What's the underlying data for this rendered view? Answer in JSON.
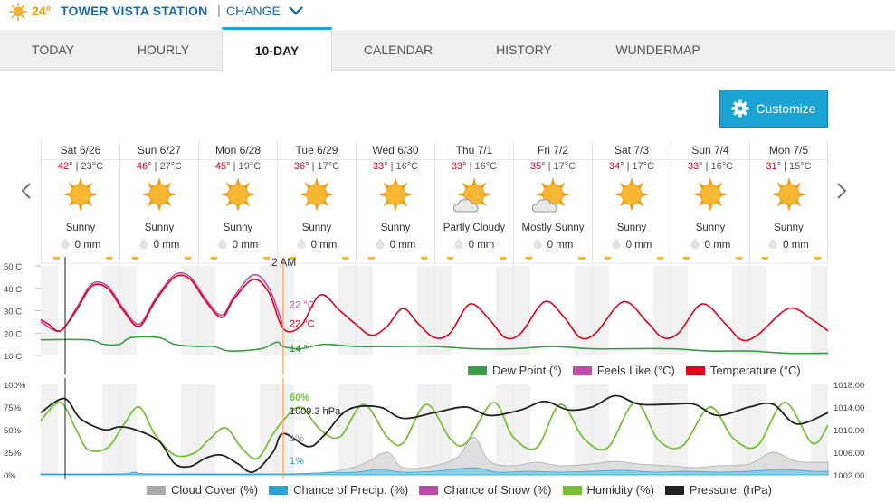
{
  "header": {
    "current_temp": "24°",
    "station_name": "TOWER VISTA STATION",
    "separator": "|",
    "change_label": "CHANGE"
  },
  "tabs": [
    {
      "label": "TODAY",
      "active": false
    },
    {
      "label": "HOURLY",
      "active": false
    },
    {
      "label": "10-DAY",
      "active": true
    },
    {
      "label": "CALENDAR",
      "active": false
    },
    {
      "label": "HISTORY",
      "active": false
    },
    {
      "label": "WUNDERMAP",
      "active": false
    }
  ],
  "customize_label": "Customize",
  "days": [
    {
      "date": "Sat 6/26",
      "hi": "42°",
      "lo": "23°C",
      "condition": "Sunny",
      "icon": "sun-icon",
      "precip": "0 mm"
    },
    {
      "date": "Sun 6/27",
      "hi": "46°",
      "lo": "27°C",
      "condition": "Sunny",
      "icon": "sun-icon",
      "precip": "0 mm"
    },
    {
      "date": "Mon 6/28",
      "hi": "45°",
      "lo": "19°C",
      "condition": "Sunny",
      "icon": "sun-icon",
      "precip": "0 mm"
    },
    {
      "date": "Tue 6/29",
      "hi": "36°",
      "lo": "17°C",
      "condition": "Sunny",
      "icon": "sun-icon",
      "precip": "0 mm"
    },
    {
      "date": "Wed 6/30",
      "hi": "33°",
      "lo": "16°C",
      "condition": "Sunny",
      "icon": "sun-icon",
      "precip": "0 mm"
    },
    {
      "date": "Thu 7/1",
      "hi": "33°",
      "lo": "16°C",
      "condition": "Partly Cloudy",
      "icon": "partly-cloudy-icon",
      "precip": "0 mm"
    },
    {
      "date": "Fri 7/2",
      "hi": "35°",
      "lo": "17°C",
      "condition": "Mostly Sunny",
      "icon": "mostly-sunny-icon",
      "precip": "0 mm"
    },
    {
      "date": "Sat 7/3",
      "hi": "34°",
      "lo": "17°C",
      "condition": "Sunny",
      "icon": "sun-icon",
      "precip": "0 mm"
    },
    {
      "date": "Sun 7/4",
      "hi": "33°",
      "lo": "16°C",
      "condition": "Sunny",
      "icon": "sun-icon",
      "precip": "0 mm"
    },
    {
      "date": "Mon 7/5",
      "hi": "31°",
      "lo": "15°C",
      "condition": "Sunny",
      "icon": "sun-icon",
      "precip": "0 mm"
    }
  ],
  "hilo_separator": " | ",
  "cursor_time": "2 AM",
  "chart_data": [
    {
      "type": "line",
      "ylim": [
        10,
        50
      ],
      "yticks": [
        "50 C",
        "40 C",
        "30 C",
        "20 C",
        "10 C"
      ],
      "x_unit": "days from Sat 6/26 00:00",
      "xlim": [
        0,
        10
      ],
      "cursor_x": 3.08,
      "readouts": {
        "feels_like": "22 °C",
        "temperature": "22 °C",
        "dew_point": "14 °"
      },
      "series": [
        {
          "name": "Dew Point (°)",
          "color": "#3a9d48",
          "points": [
            [
              0,
              17
            ],
            [
              0.6,
              17
            ],
            [
              0.8,
              15
            ],
            [
              1.0,
              15
            ],
            [
              1.15,
              18
            ],
            [
              1.5,
              18
            ],
            [
              1.7,
              15
            ],
            [
              2.0,
              14
            ],
            [
              2.2,
              14
            ],
            [
              2.4,
              12
            ],
            [
              2.8,
              13
            ],
            [
              3.0,
              16
            ],
            [
              3.08,
              14
            ],
            [
              3.3,
              13
            ],
            [
              3.6,
              15
            ],
            [
              4,
              14
            ],
            [
              4.5,
              14
            ],
            [
              5,
              14
            ],
            [
              5.5,
              13
            ],
            [
              6,
              13
            ],
            [
              6.5,
              14
            ],
            [
              7,
              13
            ],
            [
              7.5,
              13
            ],
            [
              8,
              13
            ],
            [
              8.5,
              12
            ],
            [
              9,
              12
            ],
            [
              9.5,
              11
            ],
            [
              10,
              11
            ]
          ]
        },
        {
          "name": "Feels Like (°C)",
          "color": "#c04aa8",
          "points": [
            [
              0,
              25
            ],
            [
              0.25,
              21
            ],
            [
              0.45,
              31
            ],
            [
              0.65,
              42
            ],
            [
              0.85,
              41
            ],
            [
              1.05,
              31
            ],
            [
              1.25,
              24
            ],
            [
              1.45,
              35
            ],
            [
              1.7,
              46
            ],
            [
              1.9,
              45
            ],
            [
              2.1,
              35
            ],
            [
              2.3,
              28
            ],
            [
              2.45,
              36
            ],
            [
              2.7,
              46
            ],
            [
              2.9,
              40
            ],
            [
              3.08,
              23
            ]
          ]
        },
        {
          "name": "Temperature (°C)",
          "color": "#e0001a",
          "points": [
            [
              0,
              26
            ],
            [
              0.1,
              24
            ],
            [
              0.25,
              21
            ],
            [
              0.45,
              30
            ],
            [
              0.65,
              41
            ],
            [
              0.85,
              40
            ],
            [
              1.05,
              30
            ],
            [
              1.25,
              23
            ],
            [
              1.45,
              34
            ],
            [
              1.7,
              45
            ],
            [
              1.9,
              44
            ],
            [
              2.1,
              34
            ],
            [
              2.3,
              27
            ],
            [
              2.45,
              35
            ],
            [
              2.7,
              44
            ],
            [
              2.9,
              38
            ],
            [
              3.08,
              22
            ],
            [
              3.3,
              23
            ],
            [
              3.55,
              37
            ],
            [
              3.8,
              30
            ],
            [
              4.0,
              24
            ],
            [
              4.2,
              19
            ],
            [
              4.4,
              23
            ],
            [
              4.6,
              31
            ],
            [
              4.8,
              24
            ],
            [
              5.0,
              18
            ],
            [
              5.2,
              20
            ],
            [
              5.45,
              33
            ],
            [
              5.7,
              26
            ],
            [
              5.9,
              18
            ],
            [
              6.1,
              20
            ],
            [
              6.4,
              34
            ],
            [
              6.65,
              27
            ],
            [
              6.85,
              18
            ],
            [
              7.05,
              20
            ],
            [
              7.4,
              34
            ],
            [
              7.7,
              25
            ],
            [
              7.9,
              18
            ],
            [
              8.1,
              20
            ],
            [
              8.4,
              33
            ],
            [
              8.7,
              24
            ],
            [
              8.9,
              17
            ],
            [
              9.1,
              19
            ],
            [
              9.5,
              31
            ],
            [
              9.8,
              26
            ],
            [
              10,
              21
            ]
          ]
        }
      ]
    },
    {
      "type": "line",
      "ylim": [
        0,
        100
      ],
      "yticks": [
        "100%",
        "75%",
        "50%",
        "25%",
        "0%"
      ],
      "y2lim": [
        1002,
        1018
      ],
      "y2ticks": [
        "1018.00",
        "1014.00",
        "1010.00",
        "1006.00",
        "1002.00"
      ],
      "x_unit": "days from Sat 6/26 00:00",
      "xlim": [
        0,
        10
      ],
      "cursor_x": 3.08,
      "readouts": {
        "humidity": "60%",
        "pressure": "1009.3 hPa",
        "cloud_cover": "1%",
        "precip": "1%"
      },
      "series": [
        {
          "name": "Cloud Cover (%)",
          "color": "#aaaaaa",
          "fill": "#d8d8d8",
          "points": [
            [
              0,
              1
            ],
            [
              3.0,
              1
            ],
            [
              3.5,
              2
            ],
            [
              3.8,
              5
            ],
            [
              4.1,
              12
            ],
            [
              4.4,
              25
            ],
            [
              4.6,
              8
            ],
            [
              5.0,
              10
            ],
            [
              5.3,
              20
            ],
            [
              5.5,
              42
            ],
            [
              5.7,
              15
            ],
            [
              6.0,
              10
            ],
            [
              6.3,
              14
            ],
            [
              6.6,
              10
            ],
            [
              7.0,
              12
            ],
            [
              7.3,
              15
            ],
            [
              7.6,
              12
            ],
            [
              8.0,
              10
            ],
            [
              8.3,
              8
            ],
            [
              8.6,
              10
            ],
            [
              9.0,
              12
            ],
            [
              9.3,
              25
            ],
            [
              9.6,
              15
            ],
            [
              10,
              14
            ]
          ]
        },
        {
          "name": "Chance of Precip. (%)",
          "color": "#2aa5d6",
          "fill": "#7ccbe8",
          "points": [
            [
              0,
              1
            ],
            [
              1.0,
              1
            ],
            [
              1.2,
              3
            ],
            [
              1.4,
              1
            ],
            [
              3.0,
              1
            ],
            [
              3.5,
              2
            ],
            [
              4.0,
              3
            ],
            [
              4.3,
              6
            ],
            [
              4.6,
              3
            ],
            [
              5.0,
              4
            ],
            [
              5.5,
              8
            ],
            [
              5.8,
              3
            ],
            [
              6.2,
              4
            ],
            [
              6.6,
              3
            ],
            [
              7.0,
              4
            ],
            [
              7.4,
              5
            ],
            [
              7.8,
              3
            ],
            [
              8.2,
              4
            ],
            [
              8.6,
              3
            ],
            [
              9.0,
              4
            ],
            [
              9.4,
              6
            ],
            [
              9.8,
              4
            ],
            [
              10,
              4
            ]
          ]
        },
        {
          "name": "Chance of Snow (%)",
          "color": "#c04aa8",
          "points": []
        },
        {
          "name": "Humidity (%)",
          "color": "#78c03a",
          "points": [
            [
              0,
              60
            ],
            [
              0.25,
              80
            ],
            [
              0.45,
              50
            ],
            [
              0.6,
              28
            ],
            [
              0.85,
              30
            ],
            [
              1.05,
              55
            ],
            [
              1.25,
              75
            ],
            [
              1.45,
              45
            ],
            [
              1.7,
              22
            ],
            [
              1.95,
              24
            ],
            [
              2.15,
              40
            ],
            [
              2.35,
              52
            ],
            [
              2.55,
              30
            ],
            [
              2.75,
              18
            ],
            [
              2.95,
              45
            ],
            [
              3.08,
              60
            ],
            [
              3.3,
              75
            ],
            [
              3.55,
              50
            ],
            [
              3.8,
              42
            ],
            [
              4.1,
              78
            ],
            [
              4.4,
              42
            ],
            [
              4.6,
              35
            ],
            [
              4.9,
              78
            ],
            [
              5.2,
              40
            ],
            [
              5.4,
              35
            ],
            [
              5.75,
              80
            ],
            [
              6.0,
              42
            ],
            [
              6.3,
              30
            ],
            [
              6.6,
              78
            ],
            [
              6.9,
              40
            ],
            [
              7.2,
              30
            ],
            [
              7.55,
              80
            ],
            [
              7.85,
              38
            ],
            [
              8.15,
              32
            ],
            [
              8.5,
              75
            ],
            [
              8.8,
              40
            ],
            [
              9.1,
              32
            ],
            [
              9.45,
              80
            ],
            [
              9.8,
              35
            ],
            [
              10,
              55
            ]
          ]
        },
        {
          "name": "Pressure. (hPa)",
          "color": "#222222",
          "axis": "right",
          "points": [
            [
              0,
              1013
            ],
            [
              0.3,
              1015.5
            ],
            [
              0.5,
              1012
            ],
            [
              0.8,
              1010
            ],
            [
              1.0,
              1010.5
            ],
            [
              1.2,
              1010
            ],
            [
              1.5,
              1008
            ],
            [
              1.7,
              1004
            ],
            [
              1.9,
              1003.5
            ],
            [
              2.1,
              1005
            ],
            [
              2.3,
              1005.5
            ],
            [
              2.5,
              1004
            ],
            [
              2.7,
              1002.5
            ],
            [
              2.95,
              1006
            ],
            [
              3.08,
              1009.3
            ],
            [
              3.4,
              1007
            ],
            [
              3.6,
              1009
            ],
            [
              3.9,
              1013.5
            ],
            [
              4.3,
              1014
            ],
            [
              4.6,
              1012
            ],
            [
              5.0,
              1013
            ],
            [
              5.4,
              1014
            ],
            [
              5.7,
              1012.5
            ],
            [
              6.1,
              1013.5
            ],
            [
              6.4,
              1015
            ],
            [
              6.7,
              1013.5
            ],
            [
              7.0,
              1014
            ],
            [
              7.3,
              1016
            ],
            [
              7.6,
              1014.5
            ],
            [
              8.0,
              1014.5
            ],
            [
              8.3,
              1014.5
            ],
            [
              8.6,
              1012.5
            ],
            [
              9.0,
              1014
            ],
            [
              9.3,
              1014.5
            ],
            [
              9.6,
              1011
            ],
            [
              10,
              1013
            ]
          ]
        }
      ]
    }
  ],
  "legend_top": [
    {
      "label": "Dew Point (°)",
      "color": "#3a9d48"
    },
    {
      "label": "Feels Like (°C)",
      "color": "#c04aa8"
    },
    {
      "label": "Temperature (°C)",
      "color": "#e0001a"
    }
  ],
  "legend_bottom": [
    {
      "label": "Cloud Cover (%)",
      "color": "#aaaaaa"
    },
    {
      "label": "Chance of Precip. (%)",
      "color": "#2aa5d6"
    },
    {
      "label": "Chance of Snow (%)",
      "color": "#c04aa8"
    },
    {
      "label": "Humidity (%)",
      "color": "#78c03a"
    },
    {
      "label": "Pressure. (hPa)",
      "color": "#222222"
    }
  ]
}
